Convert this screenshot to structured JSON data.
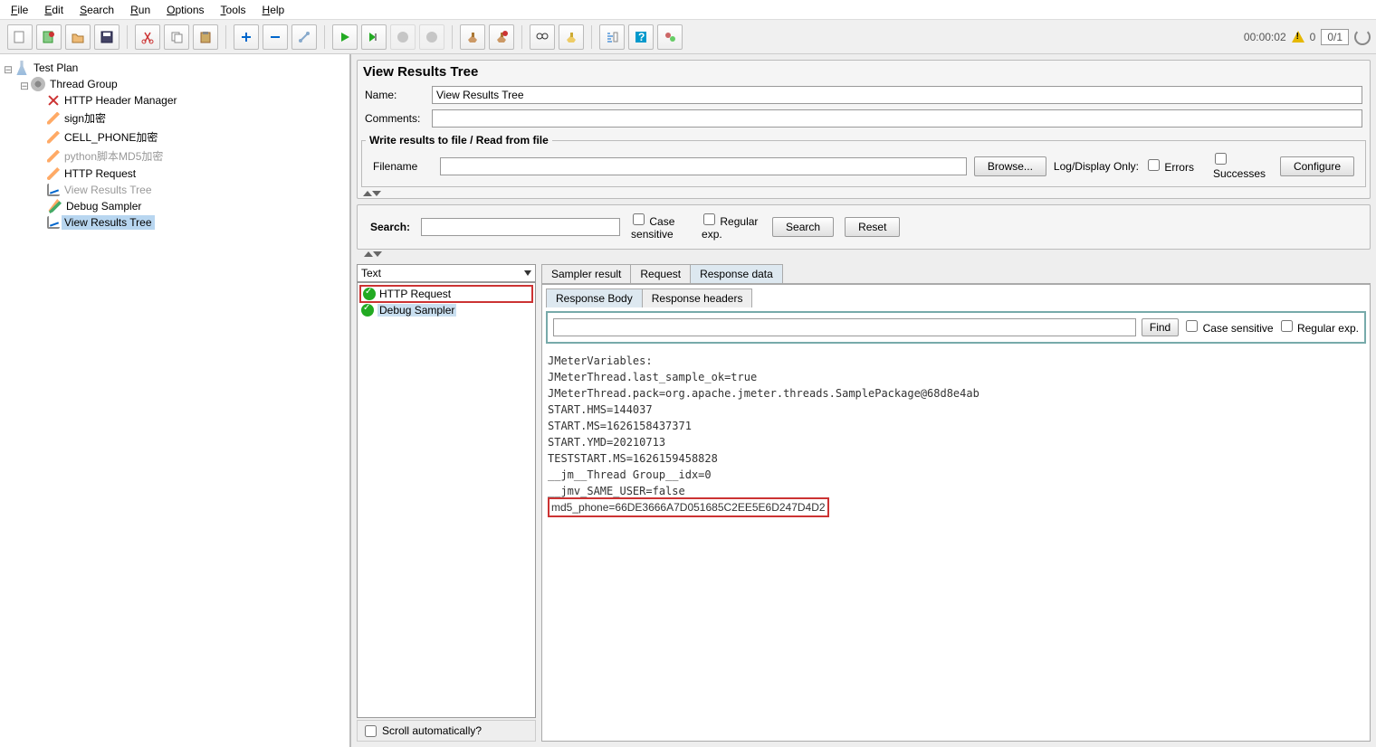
{
  "menu": [
    "File",
    "Edit",
    "Search",
    "Run",
    "Options",
    "Tools",
    "Help"
  ],
  "status": {
    "time": "00:00:02",
    "warn": "0",
    "counter": "0/1"
  },
  "tree": {
    "root": "Test Plan",
    "group": "Thread Group",
    "items": [
      {
        "label": "HTTP Header Manager",
        "icon": "x"
      },
      {
        "label": "sign加密",
        "icon": "pen"
      },
      {
        "label": "CELL_PHONE加密",
        "icon": "pen"
      },
      {
        "label": "python脚本MD5加密",
        "icon": "pen",
        "dim": true
      },
      {
        "label": "HTTP Request",
        "icon": "pen"
      },
      {
        "label": "View Results Tree",
        "icon": "chart",
        "dim": true
      },
      {
        "label": "Debug Sampler",
        "icon": "od"
      },
      {
        "label": "View Results Tree",
        "icon": "chart",
        "selected": true
      }
    ]
  },
  "right": {
    "title": "View Results Tree",
    "name_label": "Name:",
    "name_value": "View Results Tree",
    "comments_label": "Comments:",
    "comments_value": "",
    "fieldset": "Write results to file / Read from file",
    "filename_label": "Filename",
    "filename_value": "",
    "browse": "Browse...",
    "logonly": "Log/Display Only:",
    "errors": "Errors",
    "successes": "Successes",
    "configure": "Configure",
    "search_label": "Search:",
    "case": "Case sensitive",
    "regex": "Regular exp.",
    "search_btn": "Search",
    "reset_btn": "Reset",
    "combo": "Text",
    "results": [
      {
        "label": "HTTP Request",
        "hl": true
      },
      {
        "label": "Debug Sampler",
        "sel": true
      }
    ],
    "scroll": "Scroll automatically?",
    "tabs": [
      "Sampler result",
      "Request",
      "Response data"
    ],
    "subtabs": [
      "Response Body",
      "Response headers"
    ],
    "find": "Find",
    "body_lines": [
      "JMeterVariables:",
      "JMeterThread.last_sample_ok=true",
      "JMeterThread.pack=org.apache.jmeter.threads.SamplePackage@68d8e4ab",
      "START.HMS=144037",
      "START.MS=1626158437371",
      "START.YMD=20210713",
      "TESTSTART.MS=1626159458828",
      "__jm__Thread Group__idx=0",
      "__jmv_SAME_USER=false"
    ],
    "highlight": "md5_phone=66DE3666A7D051685C2EE5E6D247D4D2"
  }
}
